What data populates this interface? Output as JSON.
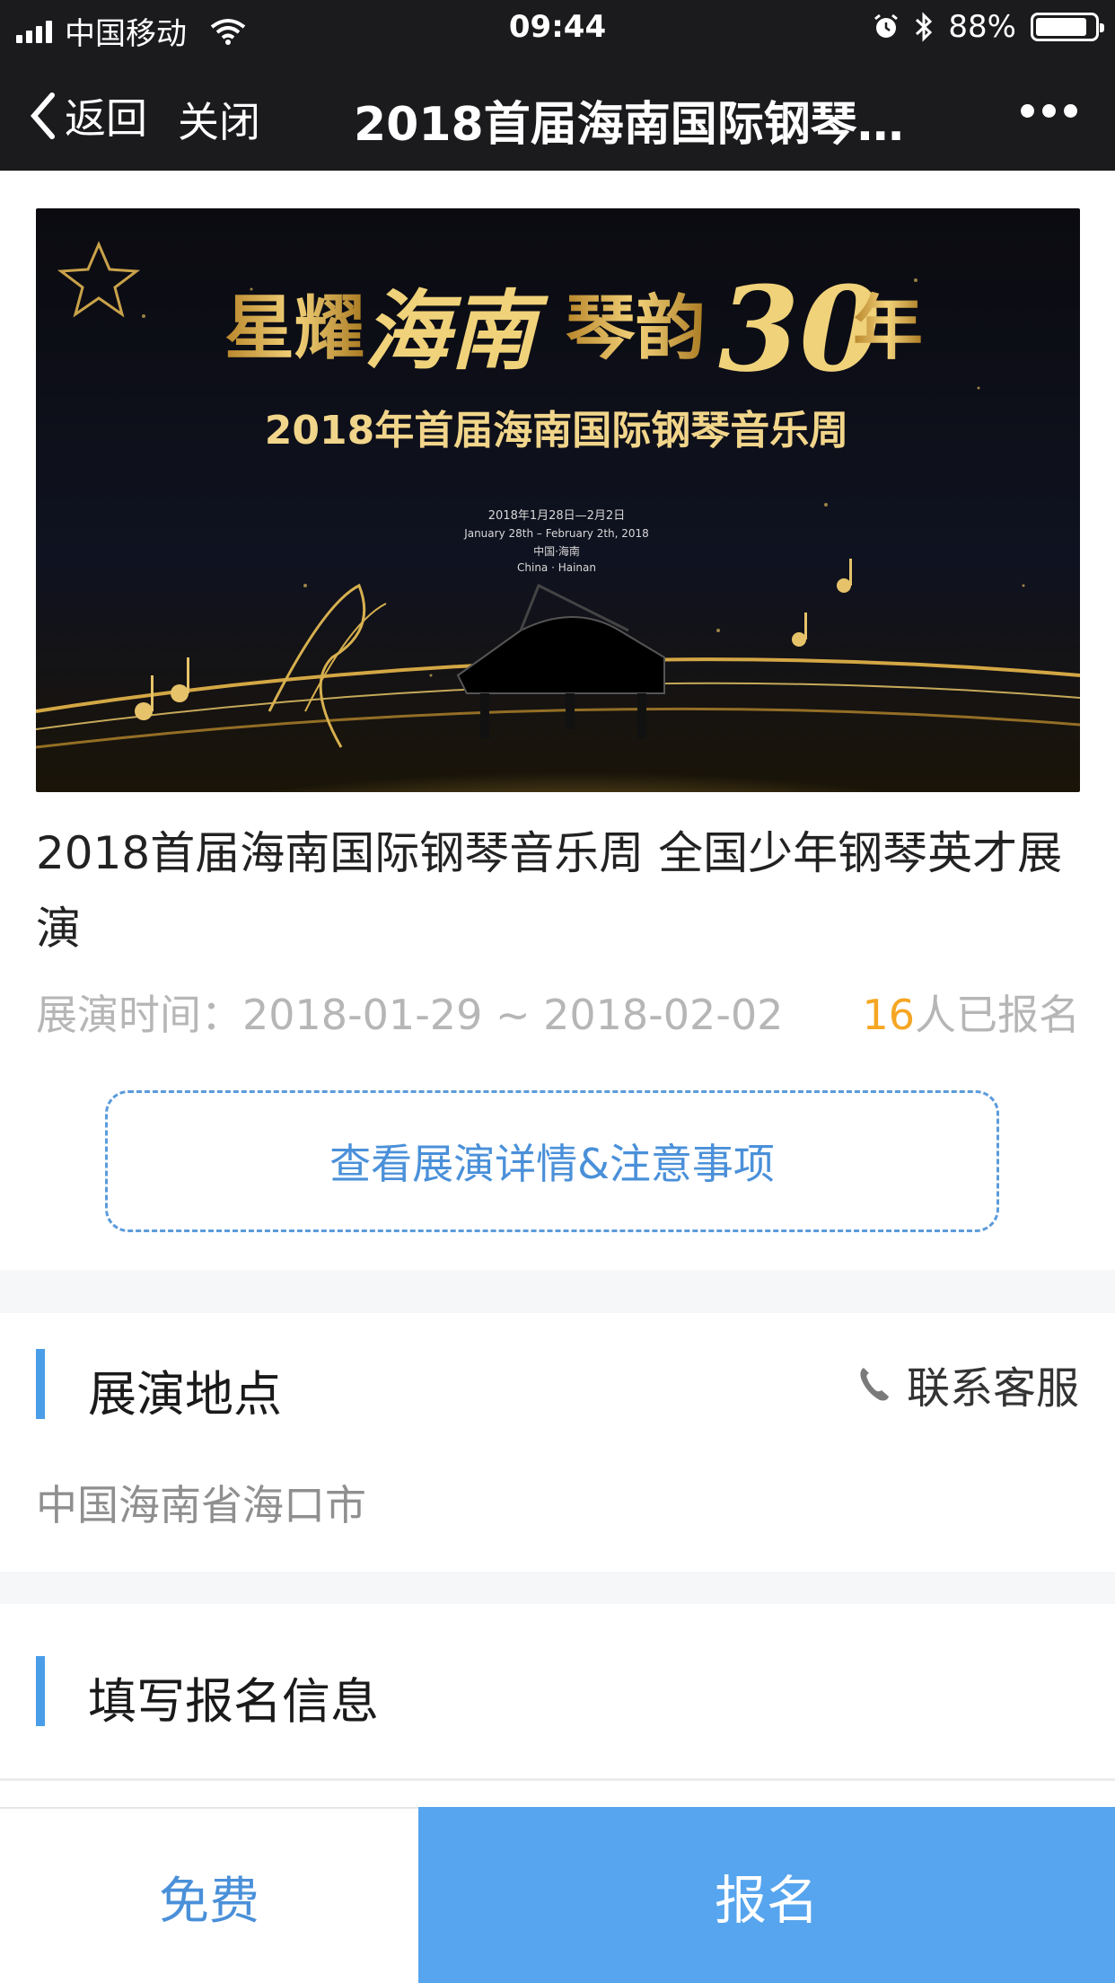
{
  "status_bar": {
    "carrier": "中国移动",
    "time": "09:44",
    "battery": "88%",
    "battery_level": 0.88
  },
  "nav": {
    "back_label": "返回",
    "close_label": "关闭",
    "title": "2018首届海南国际钢琴…"
  },
  "banner": {
    "headline_part1": "星耀",
    "headline_script1": "海南",
    "headline_part2": "琴韵",
    "headline_number": "30",
    "headline_part3": "年",
    "subtitle": "2018年首届海南国际钢琴音乐周",
    "date_cn": "2018年1月28日—2月2日",
    "date_en": "January 28th – February 2th, 2018",
    "location_cn": "中国·海南",
    "location_en": "China · Hainan"
  },
  "event": {
    "title": "2018首届海南国际钢琴音乐周 全国少年钢琴英才展演",
    "time_label": "展演时间：2018-01-29 ~ 2018-02-02",
    "count": "16",
    "count_suffix": "人已报名",
    "detail_button": "查看展演详情&注意事项"
  },
  "venue": {
    "section_title": "展演地点",
    "contact_label": "联系客服",
    "address": "中国海南省海口市"
  },
  "signup": {
    "section_title": "填写报名信息"
  },
  "bottom": {
    "price": "免费",
    "signup_button": "报名"
  },
  "colors": {
    "accent": "#4a90d9",
    "button_blue": "#57a5ee",
    "count_orange": "#f5a623",
    "section_bar": "#4a9de8",
    "header_bg": "#1b1b1d"
  },
  "icons": [
    "signal-icon",
    "wifi-icon",
    "alarm-icon",
    "bluetooth-icon",
    "battery-icon",
    "back-chevron-icon",
    "more-icon",
    "phone-icon"
  ]
}
